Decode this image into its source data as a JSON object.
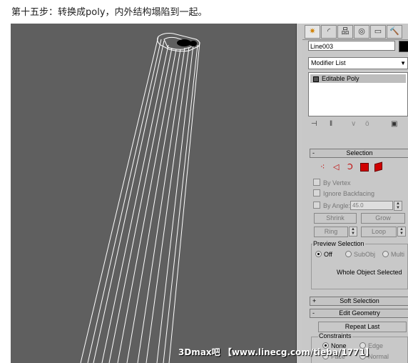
{
  "caption": "第十五步：转换成poly，内外结构塌陷到一起。",
  "panel": {
    "tabs": [
      {
        "icon": "create-icon",
        "glyph": "✷"
      },
      {
        "icon": "modify-icon",
        "glyph": "◜"
      },
      {
        "icon": "hierarchy-icon",
        "glyph": "品"
      },
      {
        "icon": "motion-icon",
        "glyph": "◎"
      },
      {
        "icon": "display-icon",
        "glyph": "▭"
      },
      {
        "icon": "utilities-icon",
        "glyph": "🔨"
      }
    ],
    "object_name": "Line003",
    "modifier_list": "Modifier List",
    "stack_item": "Editable Poly",
    "stack_buttons": [
      "pin-stack-icon",
      "show-end-result-icon",
      "make-unique-icon",
      "remove-modifier-icon",
      "configure-sets-icon"
    ],
    "selection": {
      "header": "Selection",
      "header_sign": "-",
      "subobject_icons": [
        "vertex-icon",
        "edge-icon",
        "border-icon",
        "polygon-icon",
        "element-icon"
      ],
      "by_vertex": "By Vertex",
      "ignore_backfacing": "Ignore Backfacing",
      "by_angle": "By Angle:",
      "angle_value": "45.0",
      "shrink": "Shrink",
      "grow": "Grow",
      "ring": "Ring",
      "loop": "Loop",
      "preview_label": "Preview Selection",
      "preview_off": "Off",
      "preview_subobj": "SubObj",
      "preview_multi": "Multi",
      "whole_object": "Whole Object Selected"
    },
    "soft_selection": {
      "header": "Soft Selection",
      "sign": "+"
    },
    "edit_geometry": {
      "header": "Edit Geometry",
      "sign": "-",
      "repeat_last": "Repeat Last",
      "constraints_label": "Constraints",
      "none": "None",
      "edge": "Edge",
      "face": "Face",
      "normal": "Normal"
    }
  },
  "watermark": "3Dmax吧 【www.linecg.com/tieba/1771】"
}
